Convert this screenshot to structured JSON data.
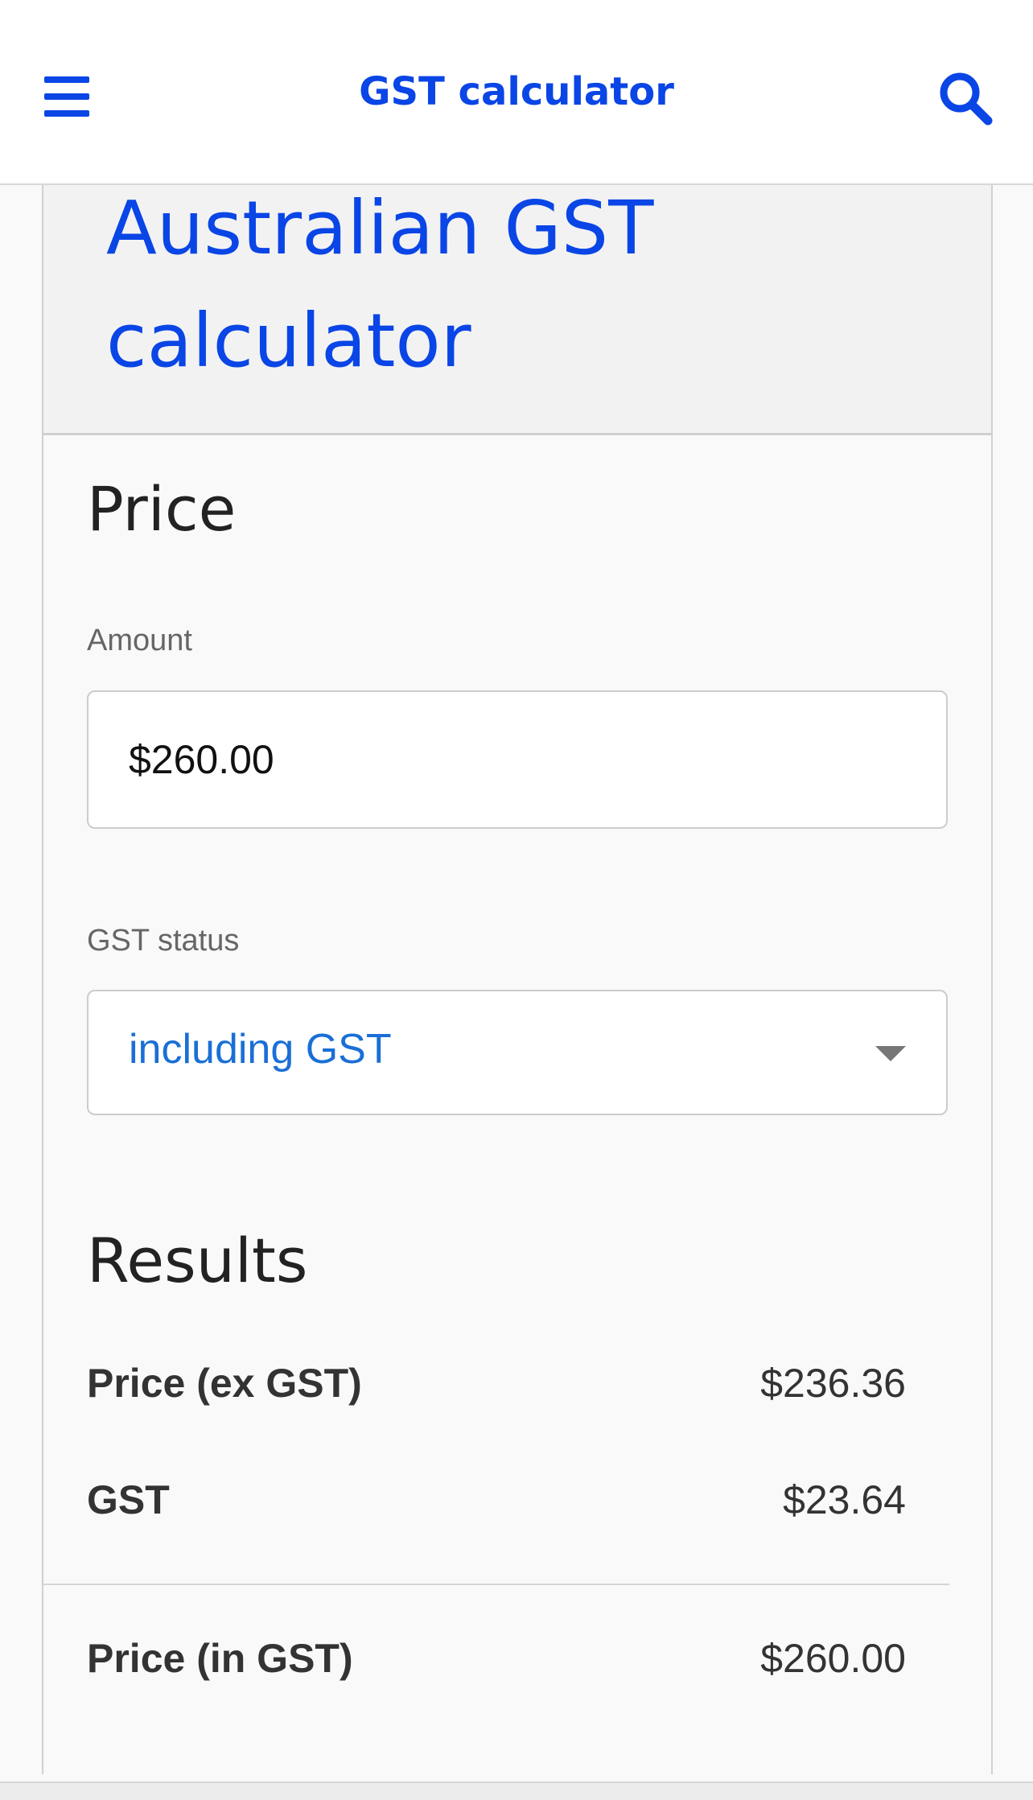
{
  "header": {
    "title": "GST calculator",
    "menu_icon": "hamburger-menu-icon",
    "search_icon": "search-icon",
    "accent_color": "#0a45e6"
  },
  "main": {
    "page_title": "Australian GST calculator",
    "price_section": {
      "heading": "Price",
      "amount_label": "Amount",
      "amount_value": "$260.00",
      "gst_status_label": "GST status",
      "gst_status_selected": "including GST"
    },
    "results_section": {
      "heading": "Results",
      "rows": [
        {
          "label": "Price (ex GST)",
          "value": "$236.36"
        },
        {
          "label": "GST",
          "value": "$23.64"
        }
      ],
      "total": {
        "label": "Price (in GST)",
        "value": "$260.00"
      }
    }
  }
}
